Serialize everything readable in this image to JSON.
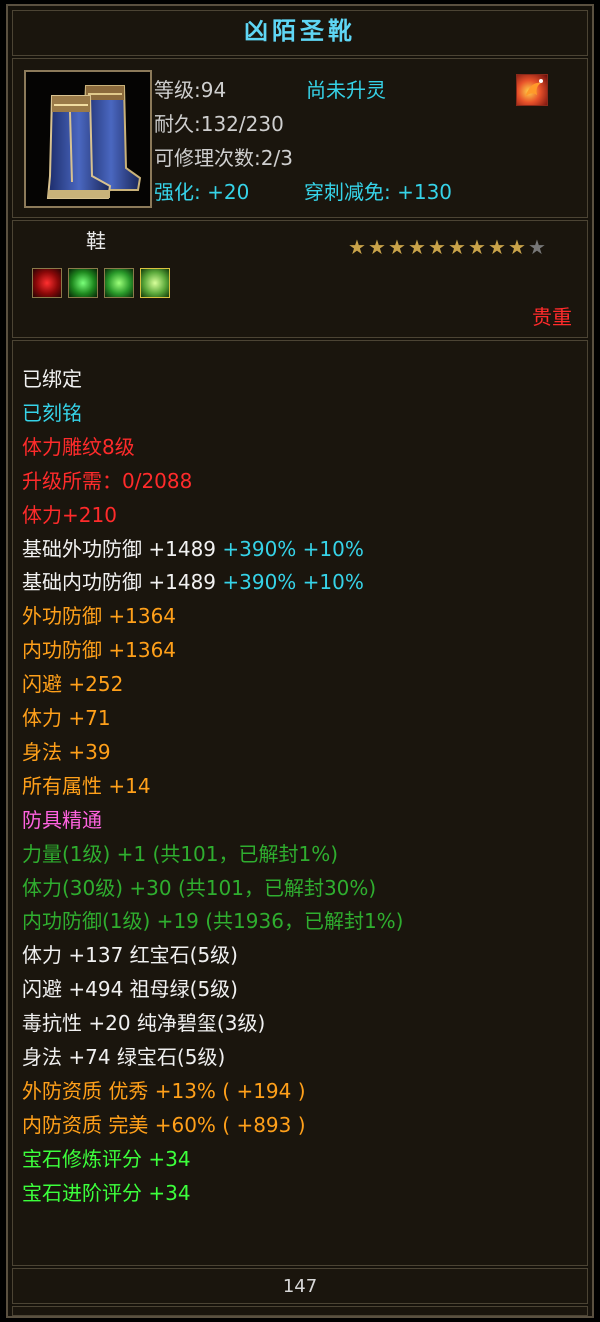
{
  "item": {
    "name": "凶陌圣靴",
    "level": "等级:94",
    "spirit_status": "尚未升灵",
    "durability": "耐久:132/230",
    "repair_count": "可修理次数:2/3",
    "enhance": "强化: +20",
    "pierce_reduce": "穿刺减免: +130",
    "slot_type": "鞋",
    "rarity": "贵重",
    "stars_filled": 9,
    "stars_total": 10,
    "stars_text": "★★★★★★★★★★",
    "gem_slot_icons": [
      "red-gem-icon",
      "green-leaf-gem-icon",
      "green-gem-icon",
      "jade-swirl-gem-icon"
    ]
  },
  "stats": [
    {
      "parts": [
        {
          "text": "已绑定",
          "color": "w"
        }
      ]
    },
    {
      "parts": [
        {
          "text": "已刻铭",
          "color": "c"
        }
      ]
    },
    {
      "parts": [
        {
          "text": "体力雕纹8级",
          "color": "r"
        }
      ]
    },
    {
      "parts": [
        {
          "text": "升级所需：0/2088",
          "color": "r"
        }
      ]
    },
    {
      "parts": [
        {
          "text": "体力+210",
          "color": "r"
        }
      ]
    },
    {
      "parts": [
        {
          "text": "基础外功防御 +1489 ",
          "color": "w"
        },
        {
          "text": "+390% +10%",
          "color": "c"
        }
      ]
    },
    {
      "parts": [
        {
          "text": "基础内功防御 +1489 ",
          "color": "w"
        },
        {
          "text": "+390% +10%",
          "color": "c"
        }
      ]
    },
    {
      "parts": [
        {
          "text": "外功防御 +1364",
          "color": "o"
        }
      ]
    },
    {
      "parts": [
        {
          "text": "内功防御 +1364",
          "color": "o"
        }
      ]
    },
    {
      "parts": [
        {
          "text": "闪避 +252",
          "color": "o"
        }
      ]
    },
    {
      "parts": [
        {
          "text": "体力 +71",
          "color": "o"
        }
      ]
    },
    {
      "parts": [
        {
          "text": "身法 +39",
          "color": "o"
        }
      ]
    },
    {
      "parts": [
        {
          "text": "所有属性 +14",
          "color": "o"
        }
      ]
    },
    {
      "parts": [
        {
          "text": "防具精通",
          "color": "p"
        }
      ]
    },
    {
      "parts": [
        {
          "text": "力量(1级) +1 (共101，已解封1%)",
          "color": "g"
        }
      ]
    },
    {
      "parts": [
        {
          "text": "体力(30级) +30 (共101，已解封30%)",
          "color": "g"
        }
      ]
    },
    {
      "parts": [
        {
          "text": "内功防御(1级) +19 (共1936，已解封1%)",
          "color": "g"
        }
      ]
    },
    {
      "parts": [
        {
          "text": "体力 +137 红宝石(5级)",
          "color": "ww"
        }
      ]
    },
    {
      "parts": [
        {
          "text": "闪避 +494 祖母绿(5级)",
          "color": "ww"
        }
      ]
    },
    {
      "parts": [
        {
          "text": "毒抗性 +20 纯净碧玺(3级)",
          "color": "ww"
        }
      ]
    },
    {
      "parts": [
        {
          "text": "身法 +74 绿宝石(5级)",
          "color": "ww"
        }
      ]
    },
    {
      "parts": [
        {
          "text": "外防资质  优秀 +13% ( +194 )",
          "color": "o"
        }
      ]
    },
    {
      "parts": [
        {
          "text": "内防资质  完美 +60% ( +893 )",
          "color": "o"
        }
      ]
    },
    {
      "parts": [
        {
          "text": "宝石修炼评分 +34",
          "color": "lg"
        }
      ]
    },
    {
      "parts": [
        {
          "text": "宝石进阶评分 +34",
          "color": "lg"
        }
      ]
    }
  ],
  "footer": {
    "count": "147"
  },
  "colors": {
    "border": "#5a5040",
    "title": "#5fd6f5",
    "cyan": "#36d3e8",
    "red": "#ff2b2b",
    "orange": "#ffa01a",
    "pink": "#ff63e0",
    "green": "#2fae2f",
    "lightgreen": "#3cff3c",
    "star": "#c9a34a"
  }
}
